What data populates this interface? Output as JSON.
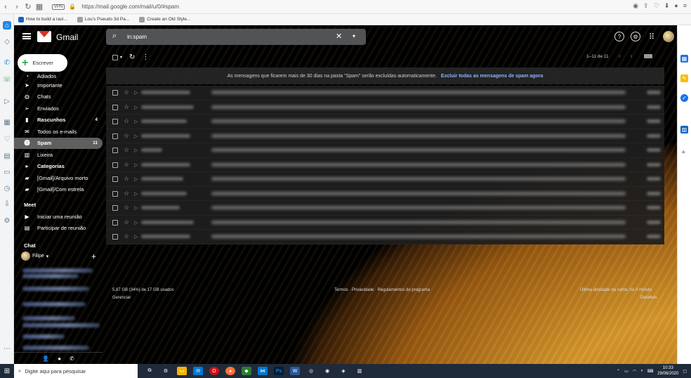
{
  "browser": {
    "vpn_label": "VPN",
    "url": "https://mail.google.com/mail/u/0/#spam",
    "bookmarks": [
      "How to build a raci...",
      "Lou's Pseudo 3d Pa...",
      "Create an Old Style..."
    ]
  },
  "gmail": {
    "brand": "Gmail",
    "search_query": "in:spam",
    "compose_label": "Escrever",
    "nav": [
      {
        "label": "Adiados",
        "count": ""
      },
      {
        "label": "Importante",
        "count": ""
      },
      {
        "label": "Chats",
        "count": ""
      },
      {
        "label": "Enviados",
        "count": ""
      },
      {
        "label": "Rascunhos",
        "count": "4"
      },
      {
        "label": "Todos os e-mails",
        "count": ""
      },
      {
        "label": "Spam",
        "count": "11"
      },
      {
        "label": "Lixeira",
        "count": ""
      },
      {
        "label": "Categorias",
        "count": ""
      },
      {
        "label": "[Gmail]/Arquivo morto",
        "count": ""
      },
      {
        "label": "[Gmail]/Com estrela",
        "count": ""
      }
    ],
    "meet": {
      "title": "Meet",
      "items": [
        "Iniciar uma reunião",
        "Participar de reunião"
      ]
    },
    "chat": {
      "title": "Chat",
      "user": "Filipe"
    },
    "pagination": "1–11 de 11",
    "banner_text": "As mensagens que ficarem mais de 30 dias na pasta \"Spam\" serão excluídas automaticamente.",
    "banner_link": "Excluir todas as mensagens de spam agora",
    "storage": "5,87 GB (34%) de 17 GB usados",
    "manage": "Gerenciar",
    "terms": "Termos · Privacidade · Regulamentos do programa",
    "last_activity": "Última atividade da conta: há 0 minuto",
    "details": "Detalhes"
  },
  "taskbar": {
    "search_placeholder": "Digite aqui para pesquisar",
    "time": "10:33",
    "date": "29/06/2020"
  },
  "colors": {
    "active_nav": "#5f5f60",
    "link": "#8ab4f8",
    "compose_plus": "#34a853",
    "taskbar": "#1f2b3a"
  }
}
